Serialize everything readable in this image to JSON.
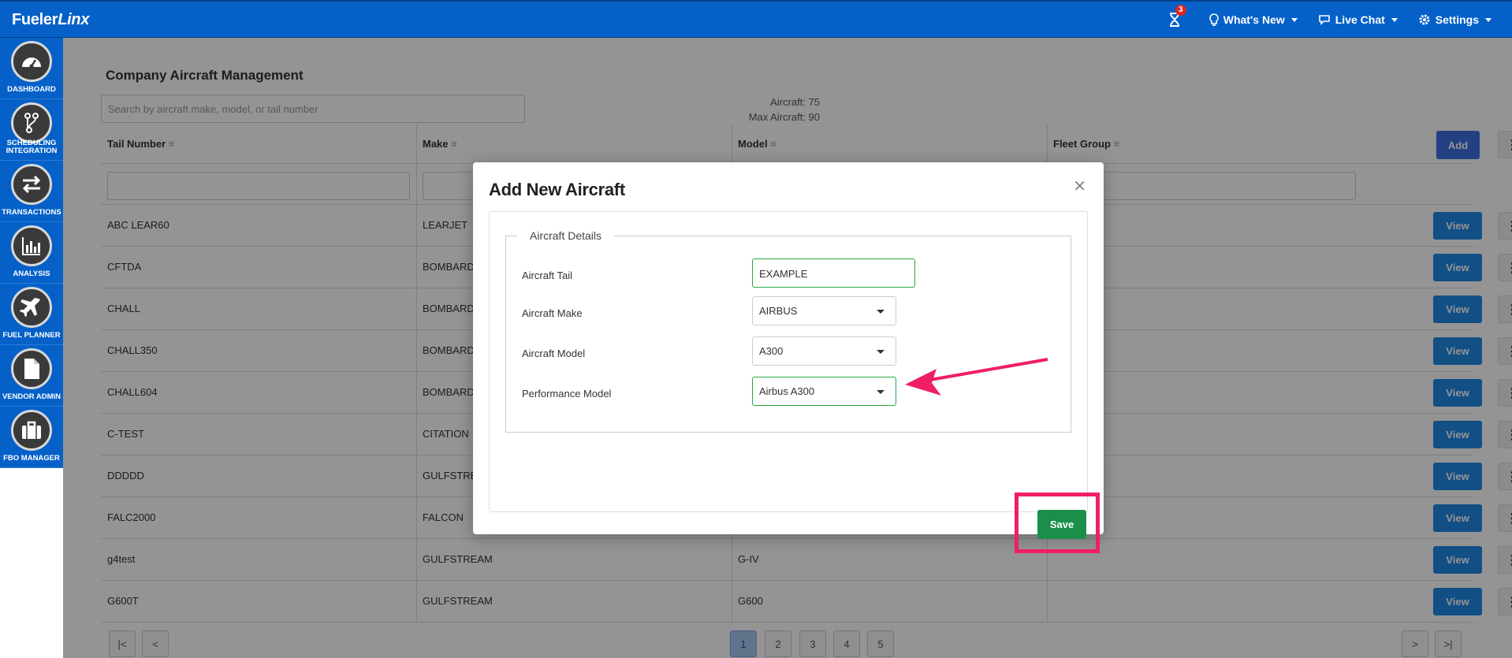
{
  "app": {
    "logo_main": "Fueler",
    "logo_italic": "Linx"
  },
  "topnav": {
    "notification_count": "3",
    "whats_new": "What's New",
    "live_chat": "Live Chat",
    "settings": "Settings"
  },
  "sidebar": {
    "items": [
      {
        "label": "DASHBOARD",
        "icon": "dashboard-icon"
      },
      {
        "label": "SCHEDULING INTEGRATION",
        "icon": "branch-icon"
      },
      {
        "label": "TRANSACTIONS",
        "icon": "transfer-icon"
      },
      {
        "label": "ANALYSIS",
        "icon": "bar-chart-icon"
      },
      {
        "label": "FUEL PLANNER",
        "icon": "plane-icon"
      },
      {
        "label": "VENDOR ADMIN",
        "icon": "document-icon"
      },
      {
        "label": "FBO MANAGER",
        "icon": "briefcase-icon"
      }
    ]
  },
  "page": {
    "title": "Company Aircraft Management",
    "search_placeholder": "Search by aircraft make, model, or tail number",
    "aircraft_count": "Aircraft: 75",
    "max_aircraft": "Max Aircraft: 90"
  },
  "table": {
    "columns": [
      "Tail Number",
      "Make",
      "Model",
      "Fleet Group"
    ],
    "add_label": "Add",
    "view_label": "View",
    "rows": [
      {
        "tail": "ABC LEAR60",
        "make": "LEARJET",
        "model": ""
      },
      {
        "tail": "CFTDA",
        "make": "BOMBARDIER",
        "model": ""
      },
      {
        "tail": "CHALL",
        "make": "BOMBARDIER",
        "model": ""
      },
      {
        "tail": "CHALL350",
        "make": "BOMBARDIER",
        "model": ""
      },
      {
        "tail": "CHALL604",
        "make": "BOMBARDIER",
        "model": ""
      },
      {
        "tail": "C-TEST",
        "make": "CITATION",
        "model": ""
      },
      {
        "tail": "DDDDD",
        "make": "GULFSTREAM",
        "model": ""
      },
      {
        "tail": "FALC2000",
        "make": "FALCON",
        "model": ""
      },
      {
        "tail": "g4test",
        "make": "GULFSTREAM",
        "model": "G-IV"
      },
      {
        "tail": "G600T",
        "make": "GULFSTREAM",
        "model": "G600"
      }
    ]
  },
  "pagination": {
    "pages": [
      "1",
      "2",
      "3",
      "4",
      "5"
    ],
    "current": "1"
  },
  "modal": {
    "title": "Add New Aircraft",
    "section_legend": "Aircraft Details",
    "tail_label": "Aircraft Tail",
    "tail_value": "EXAMPLE",
    "make_label": "Aircraft Make",
    "make_value": "AIRBUS",
    "model_label": "Aircraft Model",
    "model_value": "A300",
    "performance_label": "Performance Model",
    "performance_value": "Airbus A300",
    "save_label": "Save"
  },
  "colors": {
    "primary": "#0561c8",
    "success": "#1a8f4a",
    "highlight": "#f01f63"
  }
}
